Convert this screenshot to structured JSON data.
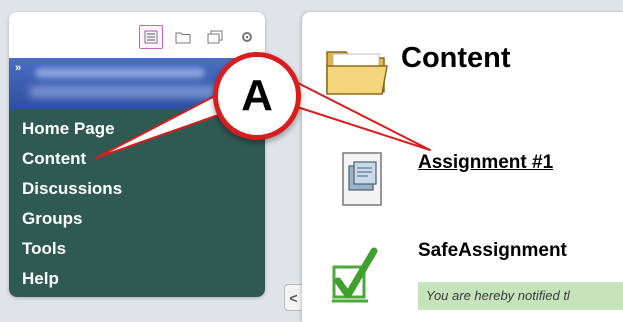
{
  "toolbar": {
    "buttons": [
      {
        "icon": "list-icon"
      },
      {
        "icon": "folder-icon"
      },
      {
        "icon": "window-icon"
      },
      {
        "icon": "gear-icon"
      }
    ]
  },
  "course_header": {
    "collapse_glyph": "»"
  },
  "menu": {
    "items": [
      {
        "label": "Home Page"
      },
      {
        "label": "Content"
      },
      {
        "label": "Discussions"
      },
      {
        "label": "Groups"
      },
      {
        "label": "Tools"
      },
      {
        "label": "Help"
      }
    ]
  },
  "content": {
    "title": "Content",
    "items": [
      {
        "label": "Assignment #1",
        "icon": "assignment-icon",
        "link": true
      },
      {
        "label": "SafeAssignment",
        "icon": "checkmark-icon",
        "link": false,
        "notice": "You are hereby notified tl"
      }
    ]
  },
  "collapse_tab": {
    "glyph": "<"
  },
  "callout": {
    "label": "A",
    "color": "#d81d1d"
  },
  "colors": {
    "menu_bg": "#2f5a52",
    "header_bg": "#3a5fb5",
    "notice_bg": "#c6e3bc"
  }
}
